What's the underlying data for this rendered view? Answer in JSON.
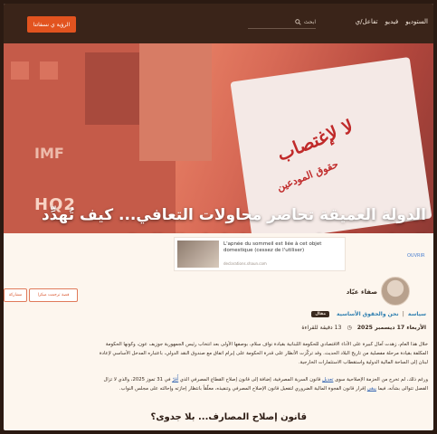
{
  "header": {
    "nav": [
      "الستوديو",
      "فيديو",
      "تفاعل/ي"
    ],
    "search_label": "ابحث",
    "cta_label": "الرؤية ي نسفاتنا"
  },
  "hero": {
    "headline": "الدولة العميقة تحاصر محاولات التعافي... كيف تُهدِّد القوانين الشكلية مستقبل لبنان المالي؟",
    "sign_text": "لا لإغتصاب",
    "sign_text2": "حقوق المودعين",
    "building_text_1": "IMF",
    "building_text_2": "HQ2"
  },
  "ad": {
    "title": "L'apnée du sommeil est liée à cet objet domestique (cessez de l'utiliser)",
    "url": "declarations.shaun.com",
    "open_label": "OUVRIR"
  },
  "author": {
    "name": "صفاء عيّاد",
    "share_1": "قصة ترجمت مبكرا",
    "share_2": "حفظ",
    "share_3": "مشاركة"
  },
  "tags": {
    "section": "سياسة",
    "separator": "|",
    "topic": "نحن والحقوق الأساسية",
    "badge": "مقال"
  },
  "meta": {
    "date": "الأربعاء 17 ديسمبر 2025",
    "read_time": "13 دقيقة للقراءة"
  },
  "body": {
    "p1_l1": "خلال هذا العام، زهدت آمال كبيرة على الأداء الاقتصادي للحكومة اللبنانية بقيادة نواف سلام، بوصفها الأولى بعد انتخاب رئيس الجمهورية جوزيف عون، وكونها الحكومة",
    "p1_l2": "المكلفة بقيادة مرحلة مفصلية من تاريخ البلاد الحديث. وقد تركّزت الأنظار على قدرة الحكومة على إبرام اتفاق مع صندوق النقد الدولي، باعتباره المدخل الأساسي لإعادة",
    "p1_l3": "لبنان إلى الساحة المالية الدولية واستقطاب الاستثمارات الخارجية.",
    "p2_l1_a": "ورغم ذلك، لم تخرج من الحزمة الإصلاحية سوى ",
    "p2_l1_link": "تعديل",
    "p2_l1_b": " قانون السرية المصرفية، إضافة إلى قانون إصلاح القطاع المصرفي الذي ",
    "p2_l1_link2": "أُقِرّ",
    "p2_l1_c": " في 31 تموز 2025، والذي لا تزال",
    "p2_l2_a": "الفصل تتوالى بشأنه، فيما ",
    "p2_l2_link": "يبقى",
    "p2_l2_b": " إقرار قانون الفجوة المالية الضروري لتفعيل قانون الإصلاح المصرفي وتنفيذه، معلّقاً بانتظار إجازته وإحالته على مجلس النواب.",
    "subhead": "قانون إصلاح المصارف... بلا جدوى؟"
  }
}
